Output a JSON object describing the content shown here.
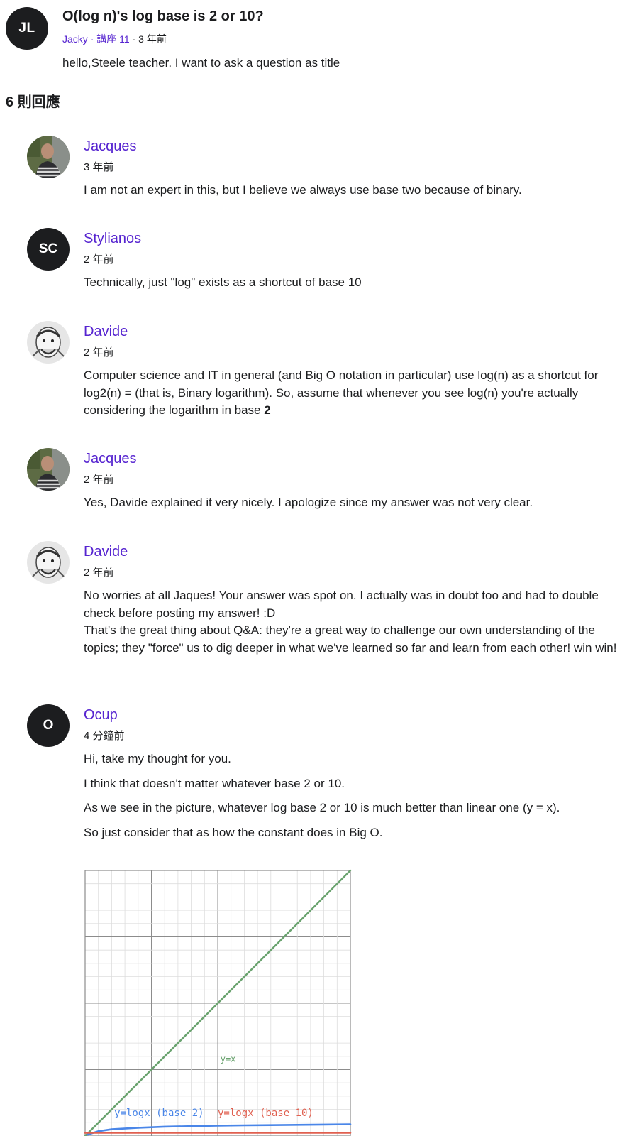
{
  "question": {
    "avatar_initials": "JL",
    "title": "O(log n)'s log base is 2 or 10?",
    "author": "Jacky",
    "separator": "·",
    "lecture": "講座 11",
    "time": "3 年前",
    "body": "hello,Steele teacher. I want to ask a question as title"
  },
  "reply_count": "6 則回應",
  "replies": [
    {
      "name": "Jacques",
      "avatar": "photo",
      "time": "3 年前",
      "paragraphs": [
        "I am not an expert in this, but I believe we always use base two because of binary."
      ]
    },
    {
      "name": "Stylianos",
      "avatar_initials": "SC",
      "time": "2 年前",
      "paragraphs": [
        "Technically, just \"log\" exists as a shortcut of base 10"
      ]
    },
    {
      "name": "Davide",
      "avatar": "photo",
      "time": "2 年前",
      "body_text": "Computer science and IT in general (and Big O notation in particular) use log(n) as a shortcut for log2(n) = (that is, Binary logarithm). So, assume that whenever you see log(n) you're actually considering the logarithm in base",
      "body_bold": "2"
    },
    {
      "name": "Jacques",
      "avatar": "photo",
      "time": "2 年前",
      "paragraphs": [
        "Yes, Davide explained it very nicely. I apologize since my answer was not very clear."
      ]
    },
    {
      "name": "Davide",
      "avatar": "photo",
      "time": "2 年前",
      "paragraphs": [
        "No worries at all Jaques! Your answer was spot on. I actually was in doubt too and had to double check before posting my answer! :D",
        "That's the great thing about Q&A: they're a great way to challenge our own understanding of the topics; they \"force\" us to dig deeper in what we've learned so far and learn from each other! win win!"
      ]
    },
    {
      "name": "Ocup",
      "avatar_initials": "O",
      "time": "4 分鐘前",
      "paragraphs": [
        "Hi, take my thought for you.",
        "I think that doesn't matter whatever base 2 or 10.",
        "As we see in the picture, whatever log base 2 or 10 is much better than linear one (y = x).",
        "So just consider that as how the constant does in Big O."
      ]
    }
  ],
  "chart_data": {
    "type": "line",
    "xlim": [
      0,
      10
    ],
    "ylim": [
      0,
      10
    ],
    "grid": true,
    "series": [
      {
        "name": "y=x",
        "color": "#6aa36f",
        "x": [
          0,
          10
        ],
        "y": [
          0,
          10
        ]
      },
      {
        "name": "y=logx (base 2)",
        "color": "#4a86e8",
        "x": [
          0.1,
          0.5,
          1,
          2,
          3,
          4,
          5,
          6,
          7,
          8,
          9,
          10
        ],
        "y": [
          0.05,
          0.18,
          0.25,
          0.31,
          0.35,
          0.37,
          0.39,
          0.4,
          0.41,
          0.42,
          0.43,
          0.44
        ]
      },
      {
        "name": "y=logx (base 10)",
        "color": "#e06050",
        "x": [
          0,
          10
        ],
        "y": [
          0.12,
          0.12
        ]
      }
    ]
  }
}
